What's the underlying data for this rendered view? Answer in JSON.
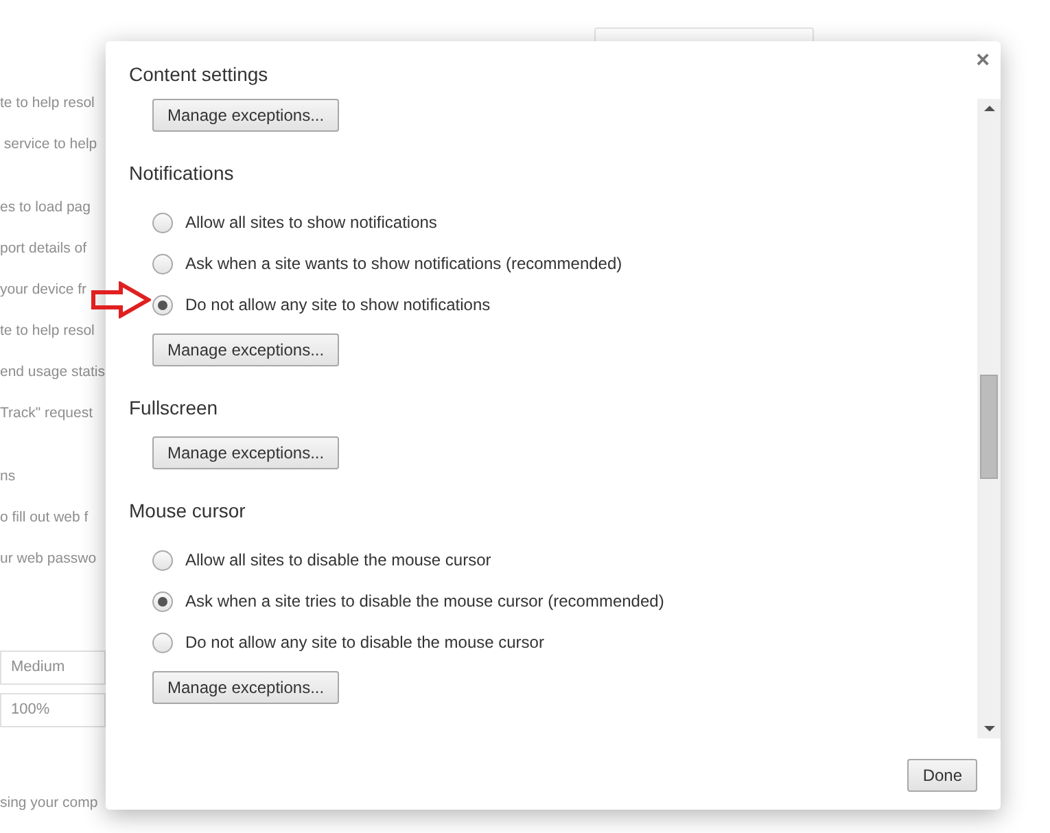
{
  "background": {
    "groups": [
      [
        "te to help resol",
        " service to help"
      ],
      [
        "es to load pag",
        "port details of",
        "your device fr",
        "te to help resol",
        "end usage statis",
        "Track\" request"
      ],
      [
        "ns",
        "o fill out web f",
        "ur web passwo"
      ]
    ],
    "selects": [
      "Medium",
      "100%"
    ],
    "footer": "sing your comp"
  },
  "dialog": {
    "title": "Content settings",
    "close": "×",
    "sections": [
      {
        "button": "Manage exceptions..."
      },
      {
        "heading": "Notifications",
        "options": [
          {
            "label": "Allow all sites to show notifications",
            "selected": false
          },
          {
            "label": "Ask when a site wants to show notifications (recommended)",
            "selected": false
          },
          {
            "label": "Do not allow any site to show notifications",
            "selected": true
          }
        ],
        "button": "Manage exceptions..."
      },
      {
        "heading": "Fullscreen",
        "button": "Manage exceptions..."
      },
      {
        "heading": "Mouse cursor",
        "options": [
          {
            "label": "Allow all sites to disable the mouse cursor",
            "selected": false
          },
          {
            "label": "Ask when a site tries to disable the mouse cursor (recommended)",
            "selected": true
          },
          {
            "label": "Do not allow any site to disable the mouse cursor",
            "selected": false
          }
        ],
        "button": "Manage exceptions..."
      }
    ],
    "done": "Done"
  }
}
